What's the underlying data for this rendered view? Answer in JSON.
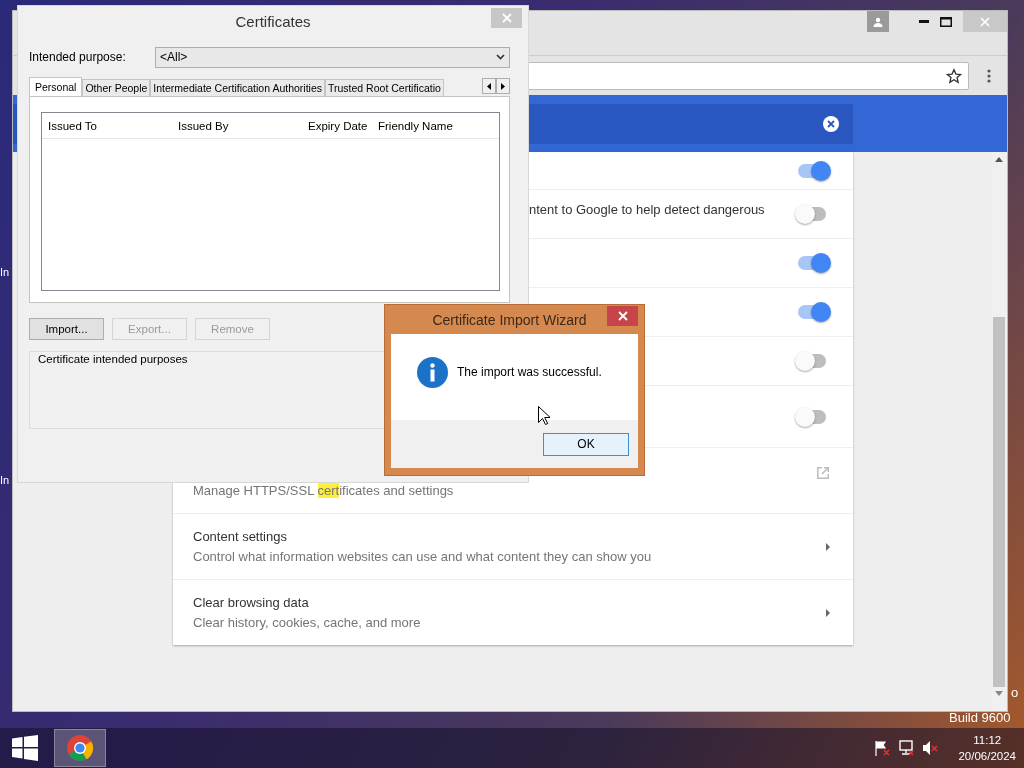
{
  "desktop": {
    "icon_labels": [
      "In",
      "In"
    ],
    "watermark": [
      "o",
      "Build 9600"
    ]
  },
  "browser": {
    "settings_rows": [
      {
        "kind": "toggle",
        "on": true
      },
      {
        "kind": "toggle",
        "text": "ntent to Google to help detect dangerous",
        "on": false
      },
      {
        "kind": "toggle",
        "on": true
      },
      {
        "kind": "toggle",
        "on": true
      },
      {
        "kind": "toggle",
        "on": false
      },
      {
        "kind": "toggle",
        "on": false
      },
      {
        "kind": "external",
        "description": {
          "before": "Manage HTTPS/SSL ",
          "highlight": "cert",
          "after": "ificates and settings"
        }
      },
      {
        "kind": "submenu",
        "title": "Content settings",
        "description": "Control what information websites can use and what content they can show you"
      },
      {
        "kind": "submenu",
        "title": "Clear browsing data",
        "description": "Clear history, cookies, cache, and more"
      }
    ]
  },
  "certificates_dialog": {
    "title": "Certificates",
    "purpose_label": "Intended purpose:",
    "purpose_value": "<All>",
    "tabs": [
      {
        "label": "Personal",
        "selected": true
      },
      {
        "label": "Other People",
        "selected": false
      },
      {
        "label": "Intermediate Certification Authorities",
        "selected": false
      },
      {
        "label": "Trusted Root Certificatio",
        "selected": false
      }
    ],
    "columns": [
      "Issued To",
      "Issued By",
      "Expiry Date",
      "Friendly Name"
    ],
    "buttons": [
      {
        "label": "Import...",
        "disabled": false
      },
      {
        "label": "Export...",
        "disabled": true
      },
      {
        "label": "Remove",
        "disabled": true
      }
    ],
    "group_label": "Certificate intended purposes"
  },
  "wizard": {
    "title": "Certificate Import Wizard",
    "message": "The import was successful.",
    "button": "OK"
  },
  "taskbar": {
    "time": "11:12",
    "date": "20/06/2024"
  }
}
